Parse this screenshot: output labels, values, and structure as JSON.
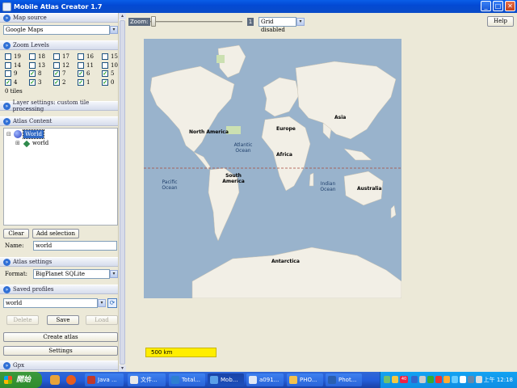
{
  "window": {
    "title": "Mobile Atlas Creator 1.7",
    "minimize": "_",
    "maximize": "□",
    "close": "✕"
  },
  "map_source": {
    "header": "Map source",
    "value": "Google Maps"
  },
  "zoom_levels": {
    "header": "Zoom Levels",
    "levels": [
      {
        "label": "19",
        "checked": false
      },
      {
        "label": "18",
        "checked": false
      },
      {
        "label": "17",
        "checked": false
      },
      {
        "label": "16",
        "checked": false
      },
      {
        "label": "15",
        "checked": false
      },
      {
        "label": "14",
        "checked": false
      },
      {
        "label": "13",
        "checked": false
      },
      {
        "label": "12",
        "checked": false
      },
      {
        "label": "11",
        "checked": false
      },
      {
        "label": "10",
        "checked": false
      },
      {
        "label": "9",
        "checked": false
      },
      {
        "label": "8",
        "checked": true
      },
      {
        "label": "7",
        "checked": true
      },
      {
        "label": "6",
        "checked": true
      },
      {
        "label": "5",
        "checked": true
      },
      {
        "label": "4",
        "checked": true
      },
      {
        "label": "3",
        "checked": true
      },
      {
        "label": "2",
        "checked": true
      },
      {
        "label": "1",
        "checked": true
      },
      {
        "label": "0",
        "checked": true
      }
    ],
    "tiles": "0 tiles"
  },
  "layer_settings": {
    "header": "Layer settings: custom tile processing"
  },
  "atlas_content": {
    "header": "Atlas Content",
    "root": "World",
    "child": "world",
    "clear": "Clear",
    "add_selection": "Add selection",
    "name_label": "Name:",
    "name_value": "world"
  },
  "atlas_settings": {
    "header": "Atlas settings",
    "format_label": "Format:",
    "format_value": "BigPlanet SQLite"
  },
  "saved_profiles": {
    "header": "Saved profiles",
    "value": "world",
    "delete": "Delete",
    "save": "Save",
    "load": "Load"
  },
  "actions": {
    "create_atlas": "Create atlas",
    "settings": "Settings"
  },
  "gpx": {
    "header": "Gpx"
  },
  "toolbar": {
    "zoom_label": "Zoom:",
    "zoom_value": "1",
    "grid": "Grid disabled",
    "help": "Help"
  },
  "map": {
    "labels": {
      "north_america": "North America",
      "atlantic": "Atlantic Ocean",
      "europe": "Europe",
      "asia": "Asia",
      "africa": "Africa",
      "south_america": "South America",
      "pacific": "Pacific Ocean",
      "indian": "Indian Ocean",
      "australia": "Australia",
      "antarctica": "Antarctica"
    },
    "scale": "500 km"
  },
  "taskbar": {
    "start": "開始",
    "tasks": [
      {
        "label": "Java ...",
        "icon_color": "#c0392b",
        "active": false
      },
      {
        "label": "文件...",
        "icon_color": "#e8e8e8",
        "active": false
      },
      {
        "label": "Total...",
        "icon_color": "#2e7fd1",
        "active": false
      },
      {
        "label": "Mob...",
        "icon_color": "#5aa0e8",
        "active": true
      },
      {
        "label": "a091...",
        "icon_color": "#dfe7f5",
        "active": false
      },
      {
        "label": "PHO...",
        "icon_color": "#f2c14e",
        "active": false
      },
      {
        "label": "Phot...",
        "icon_color": "#2a5fb0",
        "active": false
      }
    ],
    "tray_badge": "40",
    "clock": "上午 12:18"
  }
}
